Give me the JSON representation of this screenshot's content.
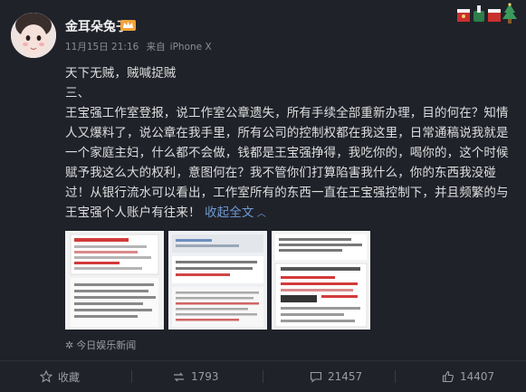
{
  "user": {
    "name": "金耳朵兔子",
    "time": "11月15日 21:16",
    "source_prefix": "来自",
    "device": "iPhone X"
  },
  "content": {
    "line1": "天下无贼，贼喊捉贼",
    "line2": "三、",
    "body": "王宝强工作室登报，说工作室公章遗失，所有手续全部重新办理，目的何在？知情人又爆料了，说公章在我手里，所有公司的控制权都在我这里，日常通稿说我就是一个家庭主妇，什么都不会做，钱都是王宝强挣得，我吃你的，喝你的，这个时候赋予我这么大的权利，意图何在？我不管你们打算陷害我什么，你的东西我没碰过！从银行流水可以看出，工作室所有的东西一直在王宝强控制下，并且频繁的与王宝强个人账户有往来！",
    "collapse_label": "收起全文"
  },
  "source": "今日娱乐新闻",
  "actions": {
    "favorite": "收藏",
    "repost": "1793",
    "comment": "21457",
    "like": "14407"
  },
  "colors": {
    "background": "#20222a",
    "link": "#6f9bd3",
    "muted": "#9a9da4"
  }
}
